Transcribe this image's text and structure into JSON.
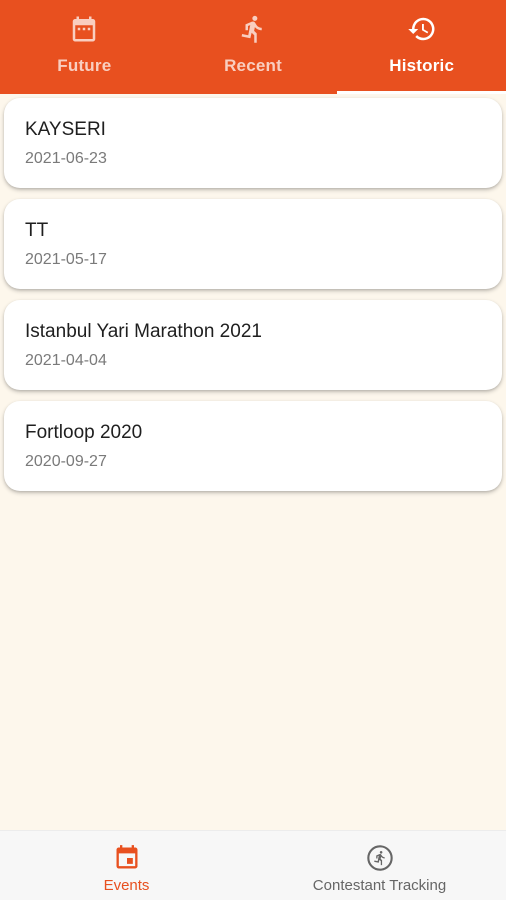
{
  "tabs": [
    {
      "label": "Future",
      "icon": "calendar-icon",
      "active": false
    },
    {
      "label": "Recent",
      "icon": "running-icon",
      "active": false
    },
    {
      "label": "Historic",
      "icon": "history-icon",
      "active": true
    }
  ],
  "events": [
    {
      "title": "KAYSERI",
      "date": "2021-06-23"
    },
    {
      "title": "TT",
      "date": "2021-05-17"
    },
    {
      "title": "Istanbul Yari Marathon 2021",
      "date": "2021-04-04"
    },
    {
      "title": "Fortloop 2020",
      "date": "2020-09-27"
    }
  ],
  "bottom_nav": [
    {
      "label": "Events",
      "icon": "event-calendar-icon",
      "active": true
    },
    {
      "label": "Contestant Tracking",
      "icon": "runner-circle-icon",
      "active": false
    }
  ],
  "colors": {
    "accent": "#e8501f",
    "background": "#fdf7ec"
  }
}
